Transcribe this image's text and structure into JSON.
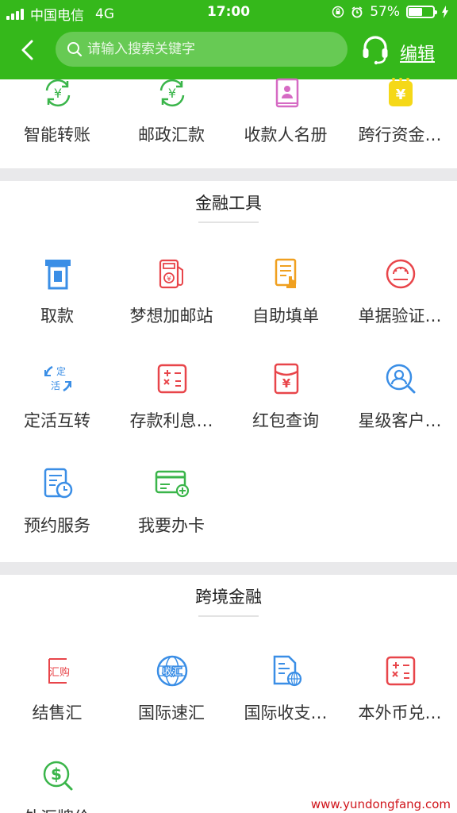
{
  "status_bar": {
    "carrier": "中国电信",
    "network": "4G",
    "time": "17:00",
    "battery_text": "57%",
    "battery_level": 0.57
  },
  "nav": {
    "search_placeholder": "请输入搜索关键字",
    "edit_label": "编辑"
  },
  "transfer": {
    "items": [
      {
        "label": "智能转账",
        "icon": "smart-transfer-icon"
      },
      {
        "label": "邮政汇款",
        "icon": "postal-remittance-icon"
      },
      {
        "label": "收款人名册",
        "icon": "payee-book-icon"
      },
      {
        "label": "跨行资金…",
        "icon": "interbank-funds-icon"
      }
    ]
  },
  "finance_tools": {
    "title": "金融工具",
    "items": [
      {
        "label": "取款",
        "icon": "atm-withdraw-icon"
      },
      {
        "label": "梦想加邮站",
        "icon": "dream-station-icon"
      },
      {
        "label": "自助填单",
        "icon": "self-fill-form-icon"
      },
      {
        "label": "单据验证…",
        "icon": "document-verify-icon"
      },
      {
        "label": "定活互转",
        "icon": "fixed-current-swap-icon"
      },
      {
        "label": "存款利息…",
        "icon": "deposit-interest-icon"
      },
      {
        "label": "红包查询",
        "icon": "red-packet-icon"
      },
      {
        "label": "星级客户…",
        "icon": "star-customer-icon"
      },
      {
        "label": "预约服务",
        "icon": "appointment-icon"
      },
      {
        "label": "我要办卡",
        "icon": "apply-card-icon"
      }
    ]
  },
  "cross_border": {
    "title": "跨境金融",
    "items": [
      {
        "label": "结售汇",
        "icon": "fx-settlement-icon",
        "icon_text": "汇购"
      },
      {
        "label": "国际速汇",
        "icon": "intl-express-icon",
        "icon_text": "收汇"
      },
      {
        "label": "国际收支…",
        "icon": "intl-payments-icon"
      },
      {
        "label": "本外币兑…",
        "icon": "currency-exchange-icon"
      },
      {
        "label": "外汇牌价",
        "icon": "fx-rate-icon"
      }
    ]
  },
  "watermark": "www.yundongfang.com",
  "colors": {
    "header_green": "#35b81b",
    "icon_green": "#3ab54a",
    "icon_blue": "#3a8ee6",
    "icon_red": "#e8454a",
    "icon_orange": "#f0a020",
    "icon_pink": "#d66bc4",
    "icon_yellow": "#f5d818"
  }
}
